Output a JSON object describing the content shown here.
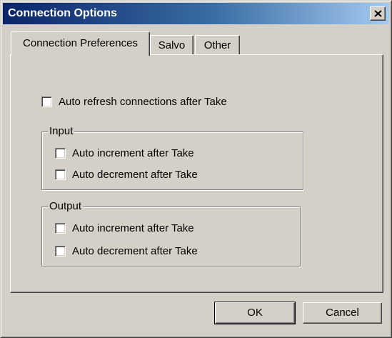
{
  "window": {
    "title": "Connection Options"
  },
  "tabs": [
    {
      "label": "Connection Preferences",
      "active": true
    },
    {
      "label": "Salvo",
      "active": false
    },
    {
      "label": "Other",
      "active": false
    }
  ],
  "options": {
    "auto_refresh": {
      "label": "Auto refresh connections after Take",
      "checked": false
    }
  },
  "input_group": {
    "legend": "Input",
    "auto_increment": {
      "label": "Auto increment after Take",
      "checked": false
    },
    "auto_decrement": {
      "label": "Auto decrement after Take",
      "checked": false
    }
  },
  "output_group": {
    "legend": "Output",
    "auto_increment": {
      "label": "Auto increment after Take",
      "checked": false
    },
    "auto_decrement": {
      "label": "Auto decrement after Take",
      "checked": false
    }
  },
  "buttons": {
    "ok": "OK",
    "cancel": "Cancel"
  },
  "colors": {
    "face": "#d4d0c8",
    "title_start": "#0a246a",
    "title_end": "#a6caf0"
  }
}
